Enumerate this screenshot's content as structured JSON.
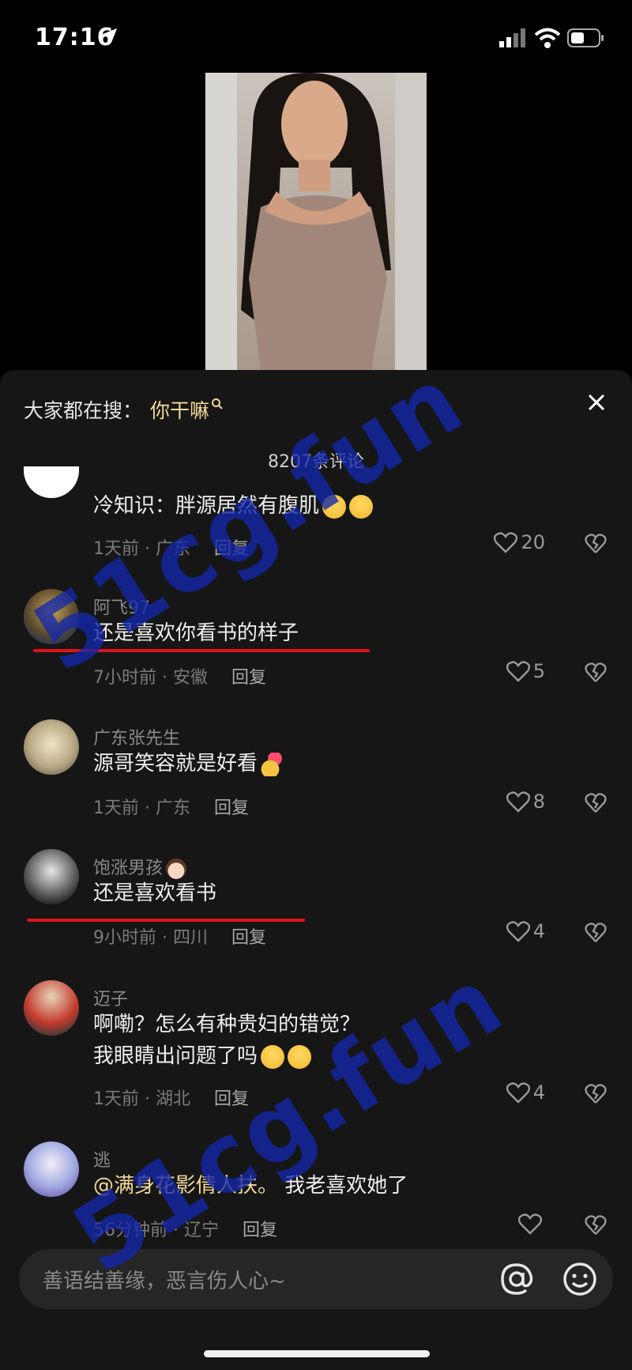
{
  "status_bar": {
    "time": "17:16"
  },
  "panel": {
    "search_prefix": "大家都在搜：",
    "search_keyword": "你干嘛",
    "comment_count": "8207条评论"
  },
  "comments": [
    {
      "username": "",
      "text": "冷知识：胖源居然有腹肌",
      "time_loc": "1天前 · 广东",
      "reply": "回复",
      "likes": "20"
    },
    {
      "username": "阿飞97",
      "text": "还是喜欢你看书的样子",
      "time_loc": "7小时前 · 安徽",
      "reply": "回复",
      "likes": "5"
    },
    {
      "username": "广东张先生",
      "text": "源哥笑容就是好看",
      "time_loc": "1天前 · 广东",
      "reply": "回复",
      "likes": "8"
    },
    {
      "username": "饱涨男孩",
      "text": "还是喜欢看书",
      "time_loc": "9小时前 · 四川",
      "reply": "回复",
      "likes": "4"
    },
    {
      "username": "迈子",
      "text_line1": "啊嘞？怎么有种贵妇的错觉？",
      "text_line2": "我眼睛出问题了吗",
      "time_loc": "1天前 · 湖北",
      "reply": "回复",
      "likes": "4"
    },
    {
      "username": "逃",
      "mention": "@满身花影倩人扶。",
      "text": "我老喜欢她了",
      "time_loc": "56分钟前 · 辽宁",
      "reply": "回复",
      "likes": ""
    }
  ],
  "input": {
    "placeholder": "善语结善缘，恶言伤人心~"
  },
  "watermark": {
    "text": "51cg.fun"
  },
  "colors": {
    "panel_bg": "#161616",
    "keyword": "#f4d999",
    "underline": "#e0141b",
    "watermark": "#1428aa"
  }
}
